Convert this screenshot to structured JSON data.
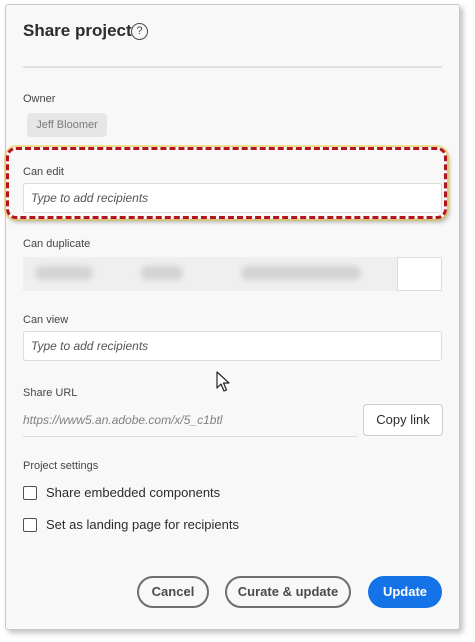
{
  "dialog": {
    "title": "Share project",
    "help_icon": "help-circle-icon",
    "help_glyph": "?"
  },
  "owner": {
    "label": "Owner",
    "name": "Jeff Bloomer"
  },
  "can_edit": {
    "label": "Can edit",
    "placeholder": "Type to add recipients"
  },
  "can_duplicate": {
    "label": "Can duplicate"
  },
  "can_view": {
    "label": "Can view",
    "placeholder": "Type to add recipients"
  },
  "share_url": {
    "label": "Share URL",
    "value": "https://www5.an.adobe.com/x/5_c1btl",
    "copy_label": "Copy link"
  },
  "project_settings": {
    "label": "Project settings",
    "options": [
      {
        "label": "Share embedded components",
        "checked": false
      },
      {
        "label": "Set as landing page for recipients",
        "checked": false
      }
    ]
  },
  "footer": {
    "cancel_label": "Cancel",
    "curate_label": "Curate & update",
    "update_label": "Update"
  },
  "colors": {
    "accent": "#1473e6",
    "highlight_border": "#b4141c"
  }
}
